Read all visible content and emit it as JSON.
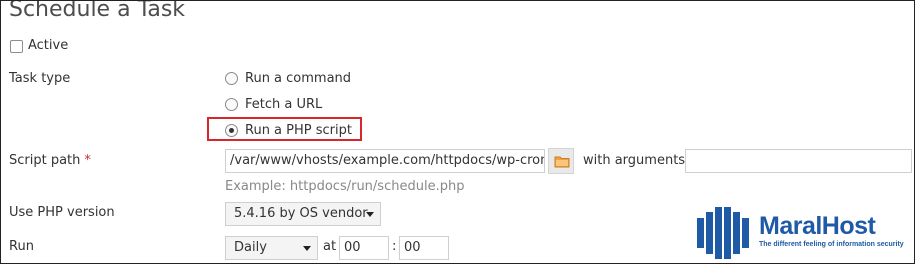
{
  "page": {
    "title": "Schedule a Task"
  },
  "active": {
    "label": "Active",
    "checked": false
  },
  "task_type": {
    "label": "Task type",
    "options": [
      {
        "label": "Run a command",
        "selected": false
      },
      {
        "label": "Fetch a URL",
        "selected": false
      },
      {
        "label": "Run a PHP script",
        "selected": true
      }
    ],
    "highlight_color": "#d7262c"
  },
  "script_path": {
    "label": "Script path",
    "required_mark": "*",
    "value": "/var/www/vhosts/example.com/httpdocs/wp-cron.php",
    "with_arguments_label": "with arguments",
    "arguments_value": "",
    "hint": "Example: httpdocs/run/schedule.php",
    "browse_icon": "folder-icon"
  },
  "php_version": {
    "label": "Use PHP version",
    "selected": "5.4.16 by OS vendor"
  },
  "run": {
    "label": "Run",
    "frequency": "Daily",
    "at_label": "at",
    "hour": "00",
    "separator": ":",
    "minute": "00"
  },
  "watermark": {
    "brand": "MaralHost",
    "tagline": "The different feeling of information security",
    "color": "#1f5aa6"
  }
}
